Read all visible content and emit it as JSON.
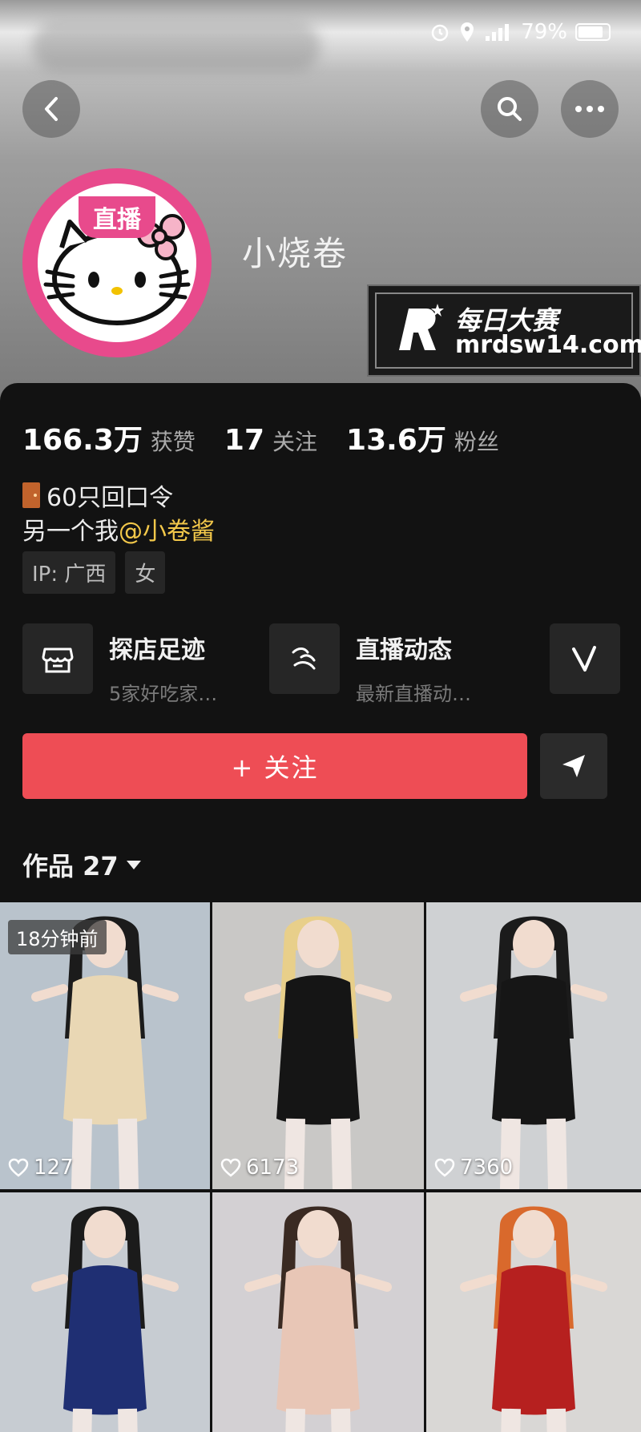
{
  "status_bar": {
    "battery": "79%"
  },
  "header": {
    "back_icon": "chevron-left-icon",
    "search_icon": "search-icon",
    "more_icon": "more-horizontal-icon"
  },
  "profile": {
    "name": "小烧卷",
    "live_badge": "直播",
    "stats": [
      {
        "value": "166.3万",
        "label": "获赞"
      },
      {
        "value": "17",
        "label": "关注"
      },
      {
        "value": "13.6万",
        "label": "粉丝"
      }
    ],
    "bio_line1": "60只回口令",
    "bio_line2_prefix": "另一个我",
    "bio_mention": "@小卷酱",
    "tags": [
      "IP: 广西",
      "女"
    ]
  },
  "watermark": {
    "title": "每日大赛",
    "url": "mrdsw14.com"
  },
  "services": [
    {
      "title": "探店足迹",
      "subtitle": "5家好吃家…",
      "icon": "store-icon"
    },
    {
      "title": "直播动态",
      "subtitle": "最新直播动…",
      "icon": "live-dynamic-icon"
    },
    {
      "title": "",
      "subtitle": "",
      "icon": "v-icon"
    }
  ],
  "actions": {
    "follow_label": "+ 关注",
    "share_icon": "send-icon"
  },
  "works": {
    "tab_label": "作品 27",
    "items": [
      {
        "time": "18分钟前",
        "likes": "127",
        "bg": "#b9c3cc"
      },
      {
        "time": "",
        "likes": "6173",
        "bg": "#c9c8c6"
      },
      {
        "time": "",
        "likes": "7360",
        "bg": "#cfd1d3"
      },
      {
        "time": "",
        "likes": "",
        "bg": "#c7ccd2"
      },
      {
        "time": "",
        "likes": "",
        "bg": "#d3d0d3"
      },
      {
        "time": "",
        "likes": "",
        "bg": "#d9d7d5"
      }
    ]
  },
  "colors": {
    "accent_follow": "#ee4d55",
    "mention": "#f3c84a",
    "avatar_ring": "#e84a8c"
  }
}
